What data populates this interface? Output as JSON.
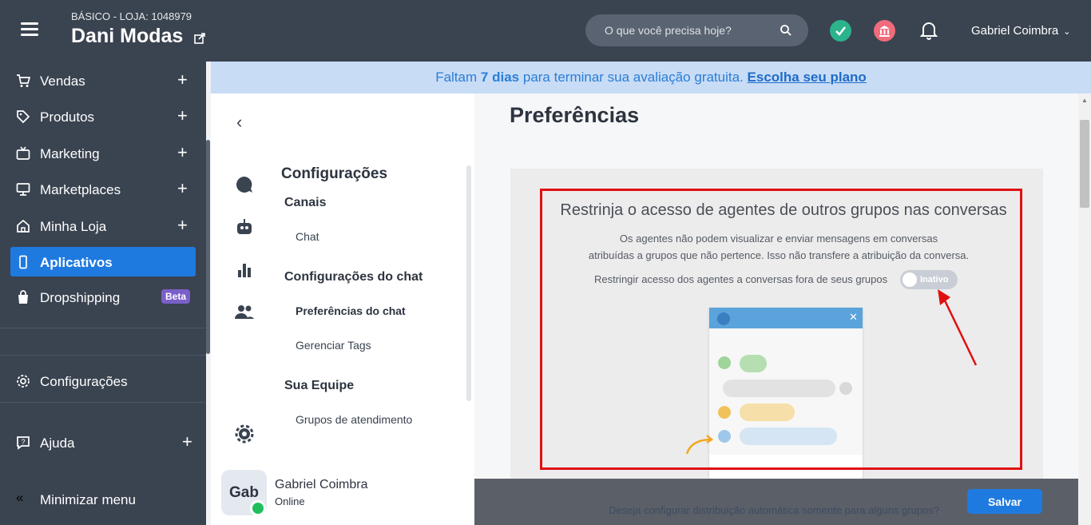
{
  "topbar": {
    "plan_label": "BÁSICO - LOJA: 1048979",
    "store_name": "Dani Modas",
    "search_placeholder": "O que você precisa hoje?",
    "user_name": "Gabriel Coimbra"
  },
  "sidebar": {
    "items": [
      {
        "label": "Vendas",
        "icon": "cart-icon"
      },
      {
        "label": "Produtos",
        "icon": "tag-icon"
      },
      {
        "label": "Marketing",
        "icon": "tv-icon"
      },
      {
        "label": "Marketplaces",
        "icon": "monitor-icon"
      },
      {
        "label": "Minha Loja",
        "icon": "home-icon"
      },
      {
        "label": "Aplicativos",
        "icon": "phone-icon"
      },
      {
        "label": "Dropshipping",
        "icon": "bag-icon",
        "badge": "Beta"
      }
    ],
    "settings_label": "Configurações",
    "help_label": "Ajuda",
    "minimize_label": "Minimizar menu"
  },
  "banner": {
    "prefix": "Faltam",
    "days_number": "7",
    "days_word": "dias",
    "middle": "para terminar sua avaliação gratuita.",
    "link": "Escolha seu plano"
  },
  "menu": {
    "title": "Configurações",
    "sections": [
      {
        "label": "Canais",
        "items": [
          "Chat"
        ]
      },
      {
        "label": "Configurações do chat",
        "items": [
          "Preferências do chat",
          "Gerenciar Tags"
        ]
      },
      {
        "label": "Sua Equipe",
        "items": [
          "Grupos de atendimento"
        ]
      }
    ],
    "selected_item": "Preferências do chat"
  },
  "agent": {
    "initials": "Gab",
    "name": "Gabriel Coimbra",
    "status": "Online"
  },
  "main": {
    "title": "Preferências",
    "card": {
      "title": "Restrinja o acesso de agentes de outros grupos nas conversas",
      "description_line1": "Os agentes não podem visualizar e enviar mensagens em conversas",
      "description_line2": "atribuídas a grupos que não pertence. Isso não transfere a atribuição da conversa.",
      "toggle_label": "Restringir acesso dos agentes a conversas fora de seus grupos",
      "toggle_state": "Inativo"
    },
    "footer_hint": "Deseja configurar distribuição automática somente para alguns grupos?",
    "save_label": "Salvar"
  },
  "colors": {
    "sidebar_bg": "#3a4350",
    "accent_blue": "#1f7ae0",
    "banner_bg": "#c8dcf6",
    "highlight_red": "#e01010",
    "success_green": "#2bb48c",
    "bank_pink": "#f06b7b"
  }
}
